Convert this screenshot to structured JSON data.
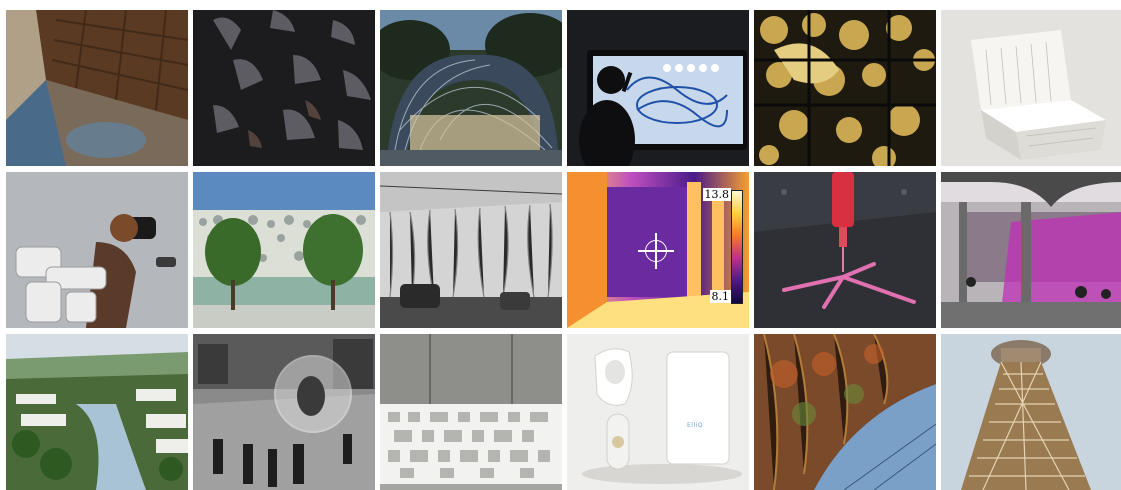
{
  "gallery": {
    "tiles": [
      {
        "name": "ornate-ceiling-photo",
        "colors": [
          "#6b4a30",
          "#3a2a20",
          "#c8b090"
        ]
      },
      {
        "name": "perforated-black-material-photo",
        "colors": [
          "#2a2a2c",
          "#0e0e10",
          "#5a5a60"
        ]
      },
      {
        "name": "woven-arch-pavilion-photo",
        "colors": [
          "#2f3a44",
          "#1c2a20",
          "#9aa8b8"
        ]
      },
      {
        "name": "drawing-screen-photo",
        "colors": [
          "#2a2c30",
          "#101114",
          "#7aa0c8"
        ]
      },
      {
        "name": "brass-instruments-wall-photo",
        "colors": [
          "#6a5a30",
          "#2a2414",
          "#c9a850"
        ]
      },
      {
        "name": "printed-white-chair-photo",
        "colors": [
          "#e8e6e2",
          "#c8c4bc",
          "#ffffff"
        ]
      },
      {
        "name": "vr-exoskeleton-photo",
        "colors": [
          "#b8bcc0",
          "#8a8e92",
          "#e4e4e4"
        ]
      },
      {
        "name": "perforated-building-facade-photo",
        "colors": [
          "#4a78b0",
          "#2a5a30",
          "#cfd4c8"
        ]
      },
      {
        "name": "wrapped-buildings-street-photo",
        "colors": [
          "#6e6e6e",
          "#3a3a3a",
          "#bdbdbd"
        ]
      },
      {
        "name": "thermal-camera-photo",
        "colors": [
          "#f5a030",
          "#5a2a9a",
          "#ffe080"
        ]
      },
      {
        "name": "pink-printing-arm-photo",
        "colors": [
          "#3a3c44",
          "#1a1c20",
          "#e05090"
        ]
      },
      {
        "name": "magenta-courtyard-photo",
        "colors": [
          "#8a6a8a",
          "#c040b0",
          "#c8c4c8"
        ]
      },
      {
        "name": "riverside-green-city-photo",
        "colors": [
          "#5a7a40",
          "#2a4a28",
          "#c8d8e0"
        ]
      },
      {
        "name": "transparent-bubble-street-photo",
        "colors": [
          "#707070",
          "#2c2c2c",
          "#bcbcbc"
        ]
      },
      {
        "name": "white-lattice-screen-photo",
        "colors": [
          "#a8a8a4",
          "#7a7a76",
          "#f4f4f2"
        ]
      },
      {
        "name": "companion-robot-photo",
        "colors": [
          "#f0f0ee",
          "#d8d6d2",
          "#ffffff"
        ]
      },
      {
        "name": "painted-market-hall-photo",
        "colors": [
          "#6a4a30",
          "#3a2a40",
          "#8ab0d0"
        ]
      },
      {
        "name": "lattice-tower-photo",
        "colors": [
          "#c8d2dc",
          "#8a7050",
          "#e8ecf0"
        ]
      }
    ],
    "thermal": {
      "max": "13.8",
      "min": "8.1"
    },
    "robot_screen_text": "ElliQ"
  }
}
